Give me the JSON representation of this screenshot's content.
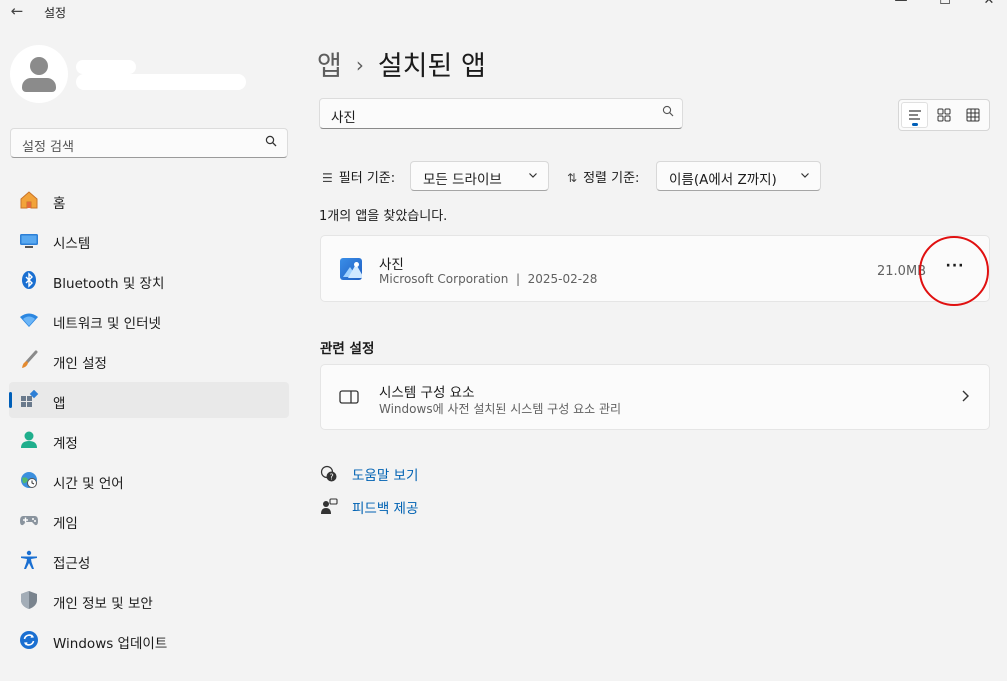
{
  "window": {
    "title": "설정",
    "back_icon": "back-arrow-icon"
  },
  "profile": {
    "avatar_icon": "user-icon"
  },
  "sidebar": {
    "search_placeholder": "설정 검색",
    "items": [
      {
        "label": "홈",
        "icon": "home-icon"
      },
      {
        "label": "시스템",
        "icon": "system-icon"
      },
      {
        "label": "Bluetooth 및 장치",
        "icon": "bluetooth-icon"
      },
      {
        "label": "네트워크 및 인터넷",
        "icon": "wifi-icon"
      },
      {
        "label": "개인 설정",
        "icon": "brush-icon"
      },
      {
        "label": "앱",
        "icon": "apps-icon",
        "active": true
      },
      {
        "label": "계정",
        "icon": "account-icon"
      },
      {
        "label": "시간 및 언어",
        "icon": "globe-clock-icon"
      },
      {
        "label": "게임",
        "icon": "gamepad-icon"
      },
      {
        "label": "접근성",
        "icon": "accessibility-icon"
      },
      {
        "label": "개인 정보 및 보안",
        "icon": "shield-icon"
      },
      {
        "label": "Windows 업데이트",
        "icon": "update-icon"
      }
    ]
  },
  "main": {
    "breadcrumb": {
      "parent": "앱",
      "separator": "›",
      "current": "설치된 앱"
    },
    "search": {
      "value": "사진"
    },
    "filter": {
      "label": "필터 기준:",
      "value": "모든 드라이브"
    },
    "sort": {
      "label": "정렬 기준:",
      "value": "이름(A에서 Z까지)"
    },
    "result_count_text": "1개의 앱을 찾았습니다.",
    "app": {
      "name": "사진",
      "publisher": "Microsoft Corporation",
      "separator": "|",
      "date": "2025-02-28",
      "size": "21.0MB",
      "more_label": "···"
    },
    "related": {
      "heading": "관련 설정",
      "item_title": "시스템 구성 요소",
      "item_sub": "Windows에 사전 설치된 시스템 구성 요소 관리"
    },
    "links": {
      "help": "도움말 보기",
      "feedback": "피드백 제공"
    }
  },
  "colors": {
    "accent": "#005fb8",
    "highlight_circle": "#e01010",
    "link": "#0062b3"
  }
}
